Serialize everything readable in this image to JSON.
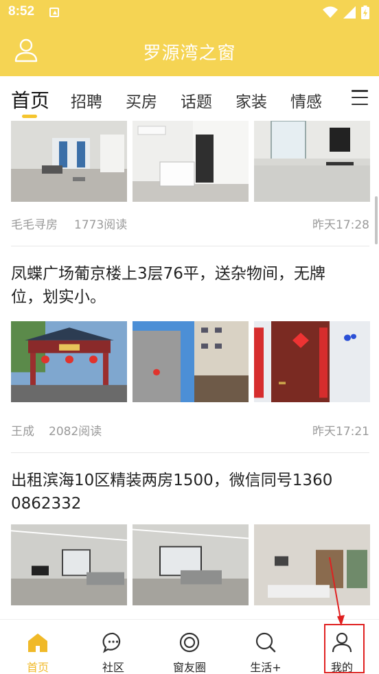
{
  "status_bar": {
    "time": "8:52"
  },
  "app_bar": {
    "title": "罗源湾之窗"
  },
  "tabs": [
    {
      "label": "首页",
      "active": true
    },
    {
      "label": "招聘"
    },
    {
      "label": "买房"
    },
    {
      "label": "话题"
    },
    {
      "label": "家装"
    },
    {
      "label": "情感"
    }
  ],
  "posts": [
    {
      "title": "",
      "author": "毛毛寻房",
      "reads": "1773阅读",
      "time": "昨天17:28",
      "thumbs": [
        "living-room-photo",
        "bedroom-photo",
        "kitchen-photo"
      ]
    },
    {
      "title": "凤蝶广场葡京楼上3层76平，送杂物间，无牌位，划实小。",
      "author": "王成",
      "reads": "2082阅读",
      "time": "昨天17:21",
      "thumbs": [
        "plaza-gate-photo",
        "building-street-photo",
        "red-door-photo"
      ]
    },
    {
      "title": "出租滨海10区精装两房1500，微信同号13600862332",
      "thumbs": [
        "apartment-living-photo",
        "apartment-sofa-photo",
        "apartment-dining-photo"
      ]
    }
  ],
  "bottom_nav": [
    {
      "label": "首页",
      "icon": "home-icon",
      "active": true
    },
    {
      "label": "社区",
      "icon": "chat-bubble-icon"
    },
    {
      "label": "窗友圈",
      "icon": "circle-ring-icon"
    },
    {
      "label": "生活+",
      "icon": "search-icon"
    },
    {
      "label": "我的",
      "icon": "person-icon"
    }
  ],
  "colors": {
    "brand_yellow": "#f5d453",
    "active_yellow": "#f0b928",
    "highlight_red": "#e02020"
  }
}
